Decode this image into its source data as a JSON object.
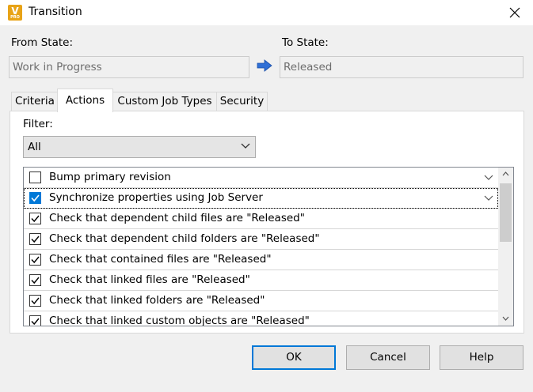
{
  "window": {
    "title": "Transition",
    "app_icon_letter": "V",
    "app_icon_sub": "PRO"
  },
  "from_state": {
    "label": "From State:",
    "value": "Work in Progress"
  },
  "to_state": {
    "label": "To State:",
    "value": "Released"
  },
  "tabs": [
    {
      "label": "Criteria",
      "active": false
    },
    {
      "label": "Actions",
      "active": true
    },
    {
      "label": "Custom Job Types",
      "active": false
    },
    {
      "label": "Security",
      "active": false
    }
  ],
  "filter": {
    "label": "Filter:",
    "value": "All"
  },
  "actions": [
    {
      "label": "Bump primary revision",
      "checked": false,
      "has_dropdown": true
    },
    {
      "label": "Synchronize properties using Job Server",
      "checked": true,
      "has_dropdown": true,
      "focused": true
    },
    {
      "label": "Check that dependent child files are \"Released\"",
      "checked": true
    },
    {
      "label": "Check that dependent child folders are \"Released\"",
      "checked": true
    },
    {
      "label": "Check that contained files are \"Released\"",
      "checked": true
    },
    {
      "label": "Check that linked files are \"Released\"",
      "checked": true
    },
    {
      "label": "Check that linked folders are \"Released\"",
      "checked": true
    },
    {
      "label": "Check that linked custom objects are \"Released\"",
      "checked": true
    }
  ],
  "buttons": {
    "ok": "OK",
    "cancel": "Cancel",
    "help": "Help"
  },
  "colors": {
    "accent": "#0078d7",
    "app_icon": "#e8a317",
    "arrow": "#2f6fd6"
  }
}
